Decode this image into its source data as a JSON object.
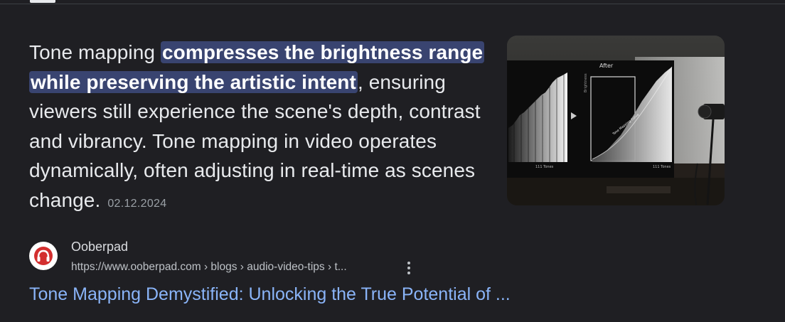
{
  "snippet": {
    "lead": "Tone mapping ",
    "highlight": "compresses the brightness range while preserving the artistic intent",
    "rest": ", ensuring viewers still experience the scene's depth, contrast and vibrancy. Tone mapping in video operates dynamically, often adjusting in real-time as scenes change.",
    "date": "02.12.2024"
  },
  "thumbnail": {
    "caption_after": "After",
    "label_left": "111 Tones",
    "label_right": "111 Tones",
    "curve_label": "Tone Mapping Curve",
    "axis_label": "Brightness"
  },
  "source": {
    "name": "Ooberpad",
    "url": "https://www.ooberpad.com › blogs › audio-video-tips › t...",
    "favicon_color": "#d32f2f"
  },
  "result": {
    "title": "Tone Mapping Demystified: Unlocking the True Potential of ..."
  }
}
